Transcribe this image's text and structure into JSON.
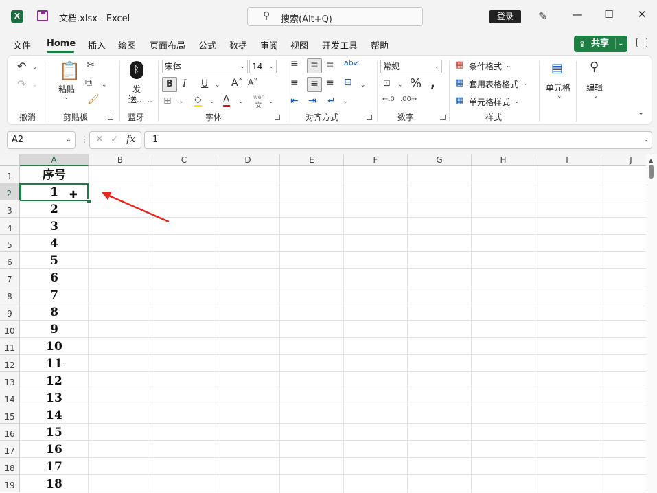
{
  "window": {
    "title": "文档.xlsx  -  Excel",
    "search_placeholder": "搜索(Alt+Q)",
    "login": "登录"
  },
  "menu": {
    "items": [
      "文件",
      "Home",
      "插入",
      "绘图",
      "页面布局",
      "公式",
      "数据",
      "审阅",
      "视图",
      "开发工具",
      "帮助"
    ],
    "share": "共享"
  },
  "ribbon": {
    "clipboard": {
      "paste": "粘贴",
      "label": "剪贴板"
    },
    "undo_label": "撤消",
    "bluetooth": {
      "send": "发",
      "send2": "送......",
      "label": "蓝牙"
    },
    "font": {
      "name": "宋体",
      "size": "14",
      "bold": "B",
      "italic": "I",
      "underline": "U",
      "label": "字体",
      "phonetic_top": "wén",
      "phonetic_char": "文"
    },
    "alignment": {
      "label": "对齐方式"
    },
    "number": {
      "format": "常规",
      "label": "数字"
    },
    "styles": {
      "conditional": "条件格式",
      "table": "套用表格格式",
      "cell": "单元格样式",
      "label": "样式"
    },
    "cells": {
      "label": "单元格"
    },
    "editing": {
      "label": "编辑"
    }
  },
  "formula_bar": {
    "name_box": "A2",
    "fx": "fx",
    "content": "1"
  },
  "sheet": {
    "columns": [
      "A",
      "B",
      "C",
      "D",
      "E",
      "F",
      "G",
      "H",
      "I",
      "J"
    ],
    "rows": [
      "1",
      "2",
      "3",
      "4",
      "5",
      "6",
      "7",
      "8",
      "9",
      "10",
      "11",
      "12",
      "13",
      "14",
      "15",
      "16",
      "17",
      "18",
      "19"
    ],
    "colA": [
      "序号",
      "1",
      "2",
      "3",
      "4",
      "5",
      "6",
      "7",
      "8",
      "9",
      "10",
      "11",
      "12",
      "13",
      "14",
      "15",
      "16",
      "17",
      "18"
    ],
    "selected_cell": "A2"
  },
  "annotation": {
    "arrow_color": "#e8251f"
  },
  "colors": {
    "accent": "#1d7f43"
  }
}
